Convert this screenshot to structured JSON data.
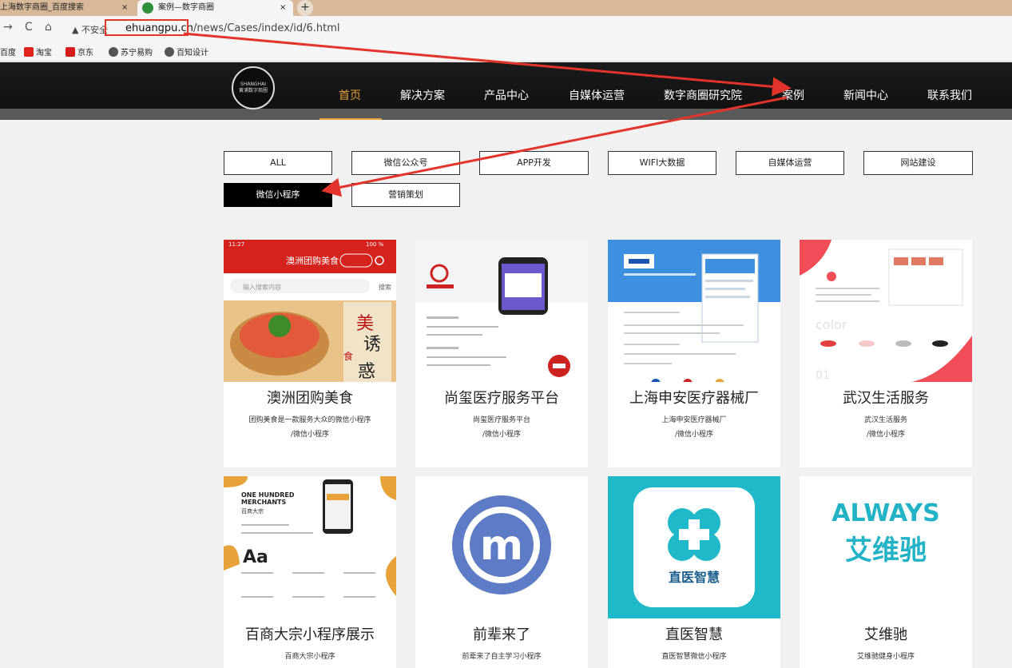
{
  "browser": {
    "tabs": [
      {
        "label": "上海数字商圈_百度搜索",
        "close": "×"
      },
      {
        "label": "案例—数字商圈",
        "close": "×"
      }
    ],
    "new_tab": "+",
    "nav": {
      "back": "→",
      "reload": "C",
      "home": "⌂"
    },
    "security_label": "不安全",
    "url_domain": "ehuangpu.cn",
    "url_path": "/news/Cases/index/id/6.html",
    "bookmarks": [
      "百度",
      "淘宝",
      "京东",
      "苏宁易购",
      "百知设计"
    ]
  },
  "site": {
    "logo": {
      "line1": "SHANGHAI",
      "line2": "黄浦数字商圈"
    },
    "nav": [
      "首页",
      "解决方案",
      "产品中心",
      "自媒体运营",
      "数字商圈研究院",
      "案例",
      "新闻中心",
      "联系我们"
    ],
    "filters": [
      "ALL",
      "微信公众号",
      "APP开发",
      "WIFI大数据",
      "自媒体运营",
      "网站建设",
      "微信小程序",
      "营销策划"
    ],
    "active_filter": "微信小程序",
    "cards": [
      {
        "title": "澳洲团购美食",
        "desc1": "团购美食是一款服务大众的微信小程序",
        "desc2": "/微信小程序",
        "thumb": {
          "status": "11:27",
          "battery": "100 %",
          "app_title": "澳洲团购美食",
          "search_placeholder": "输入搜索内容",
          "search_btn": "搜索",
          "banner_text1": "美",
          "banner_text2": "诱",
          "banner_text3": "食",
          "banner_text4": "惑"
        }
      },
      {
        "title": "尚玺医疗服务平台",
        "desc1": "尚玺医疗服务平台",
        "desc2": "/微信小程序"
      },
      {
        "title": "上海申安医疗器械厂",
        "desc1": "上海申安医疗器械厂",
        "desc2": "/微信小程序"
      },
      {
        "title": "武汉生活服务",
        "desc1": "武汉生活服务",
        "desc2": "/微信小程序",
        "thumb": {
          "word": "color",
          "num": "01"
        }
      },
      {
        "title": "百商大宗小程序展示",
        "desc1": "百商大宗小程序",
        "desc2": "",
        "thumb": {
          "line1": "ONE HUNDRED",
          "line2": "MERCHANTS",
          "line3": "百商大宗",
          "aa": "Aa"
        }
      },
      {
        "title": "前辈来了",
        "desc1": "前辈来了自主学习小程序",
        "desc2": "",
        "thumb": {
          "letter": "m"
        }
      },
      {
        "title": "直医智慧",
        "desc1": "直医智慧微信小程序",
        "desc2": "",
        "thumb": {
          "brand": "直医智慧"
        }
      },
      {
        "title": "艾维驰",
        "desc1": "艾维驰健身小程序",
        "desc2": "",
        "thumb": {
          "en": "ALWAYS",
          "cn": "艾维驰"
        }
      }
    ]
  },
  "colors": {
    "annotation": "#e2342a",
    "nav_active": "#e8a23a",
    "header_bg": "#151515"
  }
}
